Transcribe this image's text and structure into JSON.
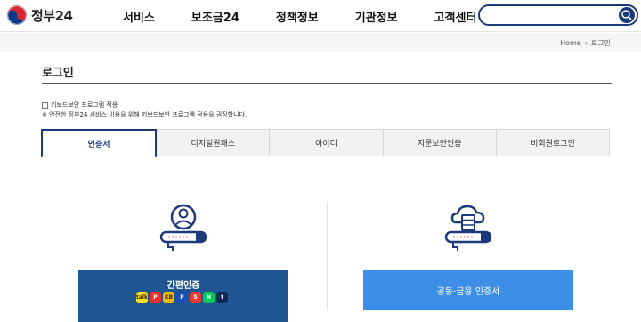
{
  "header": {
    "logo_text": "정부24",
    "nav": [
      "서비스",
      "보조금24",
      "정책정보",
      "기관정보",
      "고객센터"
    ],
    "search_placeholder": ""
  },
  "breadcrumb": {
    "home": "Home",
    "current": "로그인"
  },
  "page": {
    "title": "로그인",
    "keyboard_security_label": "키보드보안 프로그램 적용",
    "keyboard_security_note": "※ 안전한 정부24 서비스 이용을 위해 키보드보안 프로그램 적용을 권장합니다."
  },
  "tabs": [
    {
      "label": "인증서",
      "active": true
    },
    {
      "label": "디지털원패스",
      "active": false
    },
    {
      "label": "아이디",
      "active": false
    },
    {
      "label": "지문보안인증",
      "active": false
    },
    {
      "label": "비회원로그인",
      "active": false
    }
  ],
  "options": {
    "simple_auth_label": "간편인증",
    "providers": [
      {
        "name": "kakao-icon",
        "glyph": "talk",
        "bg": "#f7e017",
        "fg": "#3a1d1d"
      },
      {
        "name": "payco-icon",
        "glyph": "P",
        "bg": "#e8322b",
        "fg": "#ffffff"
      },
      {
        "name": "kb-icon",
        "glyph": "KB",
        "bg": "#f2b900",
        "fg": "#3a2a00"
      },
      {
        "name": "pass-icon",
        "glyph": "P",
        "bg": "#1d4fb8",
        "fg": "#ffffff"
      },
      {
        "name": "samsung-pass-icon",
        "glyph": "S",
        "bg": "#e73c2e",
        "fg": "#ffffff"
      },
      {
        "name": "naver-icon",
        "glyph": "N",
        "bg": "#03c75a",
        "fg": "#ffffff"
      },
      {
        "name": "toss-icon",
        "glyph": "t",
        "bg": "#0a2a57",
        "fg": "#ffffff"
      }
    ],
    "cert_auth_label": "공동·금융 인증서"
  },
  "colors": {
    "brand_dark": "#1a3a7a",
    "simple_btn": "#1f5591",
    "cert_btn": "#3d8ee6"
  }
}
